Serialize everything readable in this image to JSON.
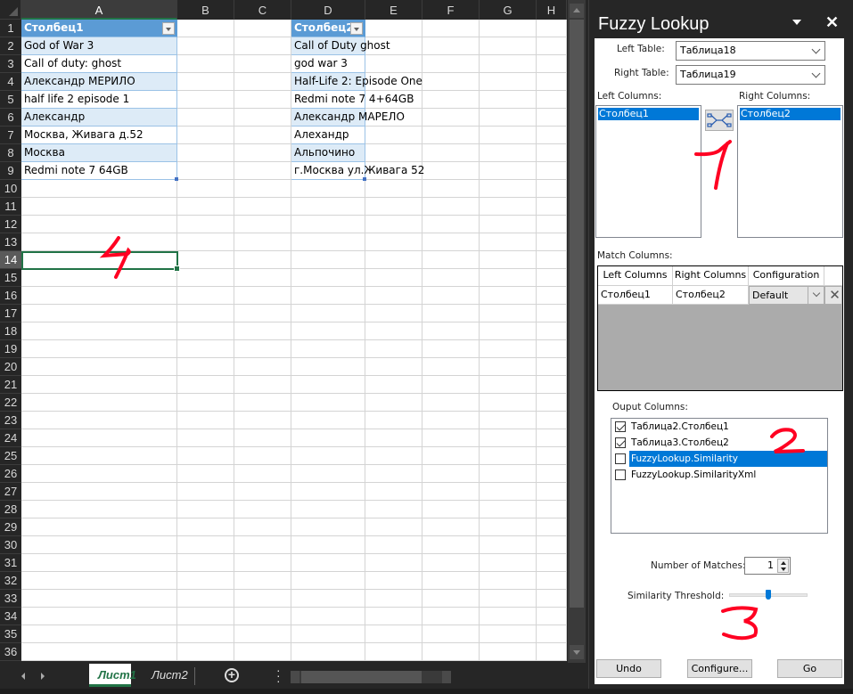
{
  "spreadsheet": {
    "columns": [
      "A",
      "B",
      "C",
      "D",
      "E",
      "F",
      "G",
      "H"
    ],
    "active_column": "A",
    "active_row": 14,
    "row_count": 36,
    "table1": {
      "header": "Столбец1",
      "rows": [
        "God of War 3",
        "Call of duty: ghost",
        "Александр МЕРИЛО",
        "half life 2 episode 1",
        "Александр",
        "Москва, Живага д.52",
        "Москва",
        "Redmi note 7 64GB"
      ]
    },
    "table2": {
      "header": "Столбец2",
      "rows": [
        "Call of Duty ghost",
        "god war 3",
        "Half-Life 2: Episode One",
        "Redmi note 7 4+64GB",
        "Александр МАРЕЛО",
        "Алехандр",
        "Альпочино",
        "г.Москва ул.Живага 52"
      ]
    },
    "sheet_tabs": [
      {
        "label": "Лист1",
        "active": true
      },
      {
        "label": "Лист2",
        "active": false
      }
    ],
    "annotations": {
      "cell": "4"
    }
  },
  "pane": {
    "title": "Fuzzy Lookup",
    "left_table_label": "Left Table:",
    "left_table_value": "Таблица18",
    "right_table_label": "Right Table:",
    "right_table_value": "Таблица19",
    "left_columns_label": "Left Columns:",
    "left_columns": [
      "Столбец1"
    ],
    "right_columns_label": "Right Columns:",
    "right_columns": [
      "Столбец2"
    ],
    "match_columns_label": "Match Columns:",
    "match_headers": [
      "Left Columns",
      "Right Columns",
      "Configuration"
    ],
    "match_rows": [
      {
        "left": "Столбец1",
        "right": "Столбец2",
        "config": "Default"
      }
    ],
    "output_columns_label": "Ouput Columns:",
    "output_columns": [
      {
        "label": "Таблица2.Столбец1",
        "checked": true,
        "selected": false
      },
      {
        "label": "Таблица3.Столбец2",
        "checked": true,
        "selected": false
      },
      {
        "label": "FuzzyLookup.Similarity",
        "checked": false,
        "selected": true
      },
      {
        "label": "FuzzyLookup.SimilarityXml",
        "checked": false,
        "selected": false
      }
    ],
    "number_of_matches_label": "Number of Matches:",
    "number_of_matches": "1",
    "similarity_threshold_label": "Similarity Threshold:",
    "similarity_threshold_fraction": 0.5,
    "buttons": {
      "undo": "Undo",
      "configure": "Configure...",
      "go": "Go"
    },
    "annotations": {
      "one": "1",
      "two": "2",
      "three": "3"
    }
  },
  "colors": {
    "table_header": "#5b9bd5",
    "table_band": "#ddebf7",
    "excel_green": "#217346",
    "selection_blue": "#0078d7",
    "annotation_red": "#ff0022"
  }
}
